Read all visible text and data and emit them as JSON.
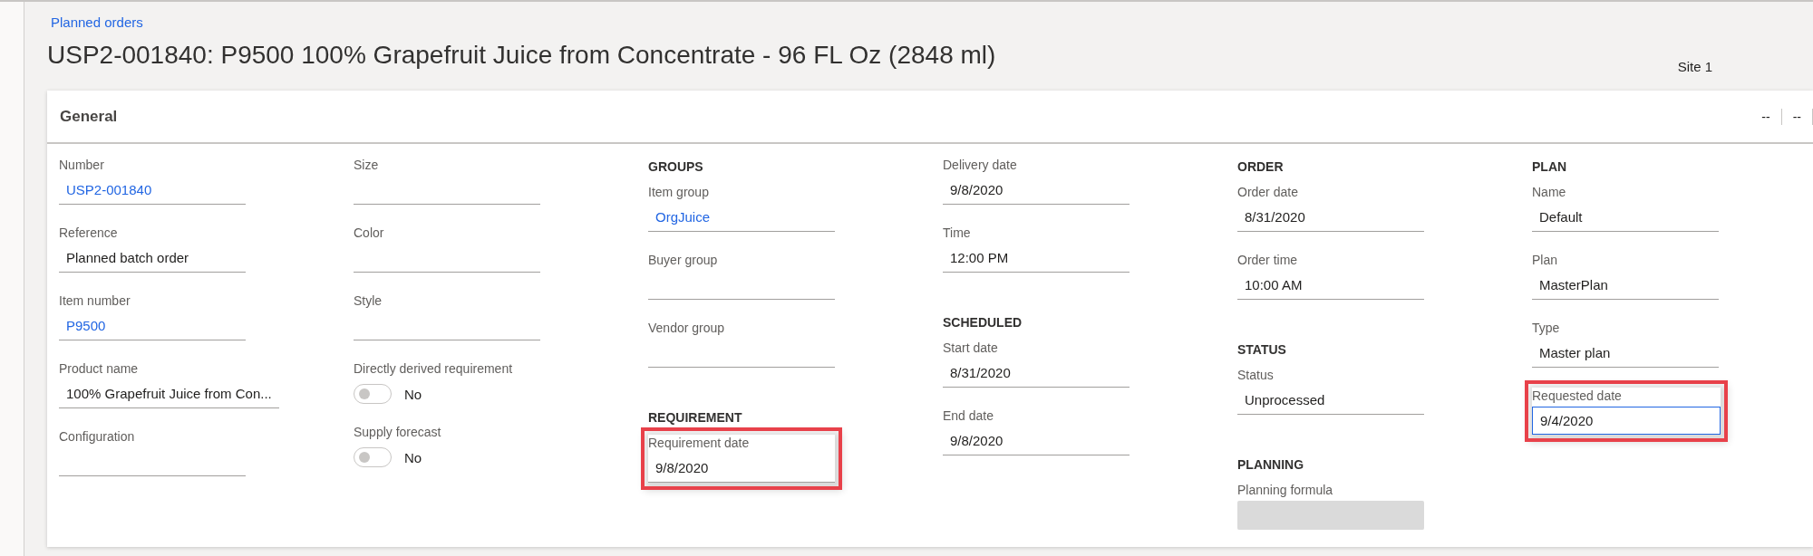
{
  "breadcrumb": "Planned orders",
  "title": "USP2-001840: P9500 100% Grapefruit Juice from Concentrate - 96 FL Oz (2848 ml)",
  "site": "Site 1",
  "card": {
    "title": "General",
    "header_actions": [
      "--",
      "--"
    ],
    "columns": [
      {
        "items": [
          {
            "kind": "field",
            "label": "Number",
            "value": "USP2-001840",
            "link": true
          },
          {
            "kind": "field",
            "label": "Reference",
            "value": "Planned batch order",
            "link": false
          },
          {
            "kind": "field",
            "label": "Item number",
            "value": "P9500",
            "link": true
          },
          {
            "kind": "field",
            "label": "Product name",
            "value": "100% Grapefruit Juice from Con...",
            "link": false
          },
          {
            "kind": "field",
            "label": "Configuration"
          }
        ]
      },
      {
        "items": [
          {
            "kind": "field",
            "label": "Size"
          },
          {
            "kind": "field",
            "label": "Color"
          },
          {
            "kind": "field",
            "label": "Style"
          },
          {
            "kind": "toggle",
            "label": "Directly derived requirement",
            "on": false,
            "text": "No"
          },
          {
            "kind": "toggle",
            "label": "Supply forecast",
            "on": false,
            "text": "No"
          }
        ]
      },
      {
        "items": [
          {
            "kind": "heading",
            "label": "GROUPS"
          },
          {
            "kind": "field",
            "label": "Item group",
            "value": "OrgJuice",
            "link": true
          },
          {
            "kind": "field",
            "label": "Buyer group"
          },
          {
            "kind": "field",
            "label": "Vendor group"
          },
          {
            "kind": "heading",
            "label": "REQUIREMENT"
          },
          {
            "kind": "field",
            "label": "Requirement date",
            "value": "9/8/2020",
            "link": false,
            "highlighted": true
          }
        ]
      },
      {
        "items": [
          {
            "kind": "field",
            "label": "Delivery date",
            "value": "9/8/2020",
            "link": false
          },
          {
            "kind": "field",
            "label": "Time",
            "value": "12:00 PM",
            "link": false
          },
          {
            "kind": "heading",
            "label": "SCHEDULED"
          },
          {
            "kind": "field",
            "label": "Start date",
            "value": "8/31/2020",
            "link": false
          },
          {
            "kind": "field",
            "label": "End date",
            "value": "9/8/2020",
            "link": false
          }
        ]
      },
      {
        "items": [
          {
            "kind": "heading",
            "label": "ORDER"
          },
          {
            "kind": "field",
            "label": "Order date",
            "value": "8/31/2020",
            "link": false
          },
          {
            "kind": "field",
            "label": "Order time",
            "value": "10:00 AM",
            "link": false
          },
          {
            "kind": "heading",
            "label": "STATUS"
          },
          {
            "kind": "field",
            "label": "Status",
            "value": "Unprocessed",
            "link": false
          },
          {
            "kind": "heading",
            "label": "PLANNING"
          },
          {
            "kind": "field",
            "label": "Planning formula",
            "disabled": true
          }
        ]
      },
      {
        "items": [
          {
            "kind": "heading",
            "label": "PLAN"
          },
          {
            "kind": "field",
            "label": "Name",
            "value": "Default",
            "link": false
          },
          {
            "kind": "field",
            "label": "Plan",
            "value": "MasterPlan",
            "link": false
          },
          {
            "kind": "field",
            "label": "Type",
            "value": "Master plan",
            "link": false
          },
          {
            "kind": "field",
            "label": "Requested date",
            "value": "9/4/2020",
            "link": false,
            "highlighted": true,
            "focused": true
          }
        ]
      }
    ]
  }
}
